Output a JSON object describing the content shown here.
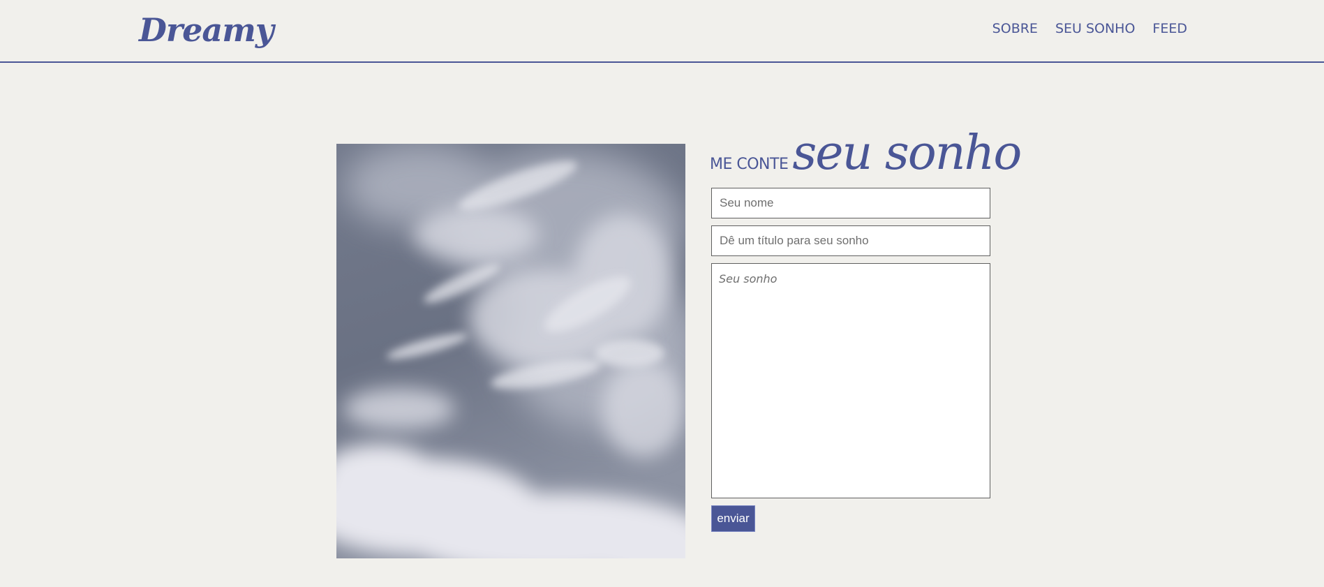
{
  "header": {
    "logo": "Dreamy",
    "nav": [
      {
        "label": "SOBRE"
      },
      {
        "label": "SEU SONHO"
      },
      {
        "label": "FEED"
      }
    ]
  },
  "form": {
    "heading_small": "ME CONTE",
    "heading_big": "seu sonho",
    "name_placeholder": "Seu nome",
    "title_placeholder": "Dê um título para seu sonho",
    "dream_placeholder": "Seu sonho",
    "submit_label": "enviar"
  },
  "colors": {
    "accent": "#4a5696",
    "background": "#f1f0ec"
  }
}
